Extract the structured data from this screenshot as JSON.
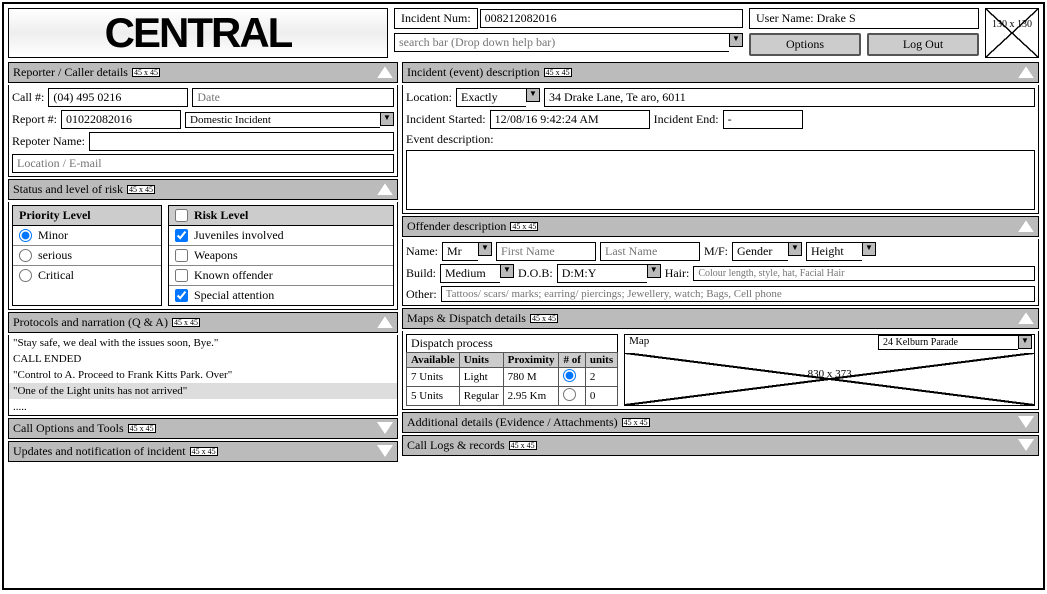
{
  "header": {
    "logo": "CENTRAL",
    "incident_num_label": "Incident Num:",
    "incident_num": "008212082016",
    "user_name_label": "User Name:",
    "user_name": "Drake S",
    "search_placeholder": "search bar (Drop down help bar)",
    "options_btn": "Options",
    "logout_btn": "Log Out",
    "avatar_text": "130 x 130"
  },
  "reporter": {
    "title": "Reporter / Caller details",
    "resize": "45 x 45",
    "call_num_label": "Call #:",
    "call_num": "(04) 495 0216",
    "date_label": "Date",
    "report_num_label": "Report #:",
    "report_num": "01022082016",
    "report_type": "Domestic Incident",
    "reporter_name_label": "Repoter Name:",
    "location_label": "Location / E-mail"
  },
  "status": {
    "title": "Status and level of risk",
    "resize": "45 x 45",
    "priority_title": "Priority Level",
    "priority": [
      "Minor",
      "serious",
      "Critical"
    ],
    "risk_title": "Risk Level",
    "risk": [
      "Juveniles involved",
      "Weapons",
      "Known offender",
      "Special attention"
    ]
  },
  "protocols": {
    "title": "Protocols and narration (Q & A)",
    "resize": "45 x 45",
    "lines": [
      "\"Stay safe, we deal with the issues soon, Bye.\"",
      "CALL ENDED",
      "\"Control to A. Proceed to Frank Kitts Park. Over\"",
      "\"One of the Light units has not arrived\"",
      "....."
    ]
  },
  "call_options": {
    "title": "Call Options and Tools",
    "resize": "45 x 45"
  },
  "updates": {
    "title": "Updates and notification of incident",
    "resize": "45 x 45"
  },
  "incident": {
    "title": "Incident (event) description",
    "resize": "45 x 45",
    "location_label": "Location:",
    "location_type": "Exactly",
    "address": "34 Drake Lane, Te aro, 6011",
    "started_label": "Incident Started:",
    "started": "12/08/16 9:42:24 AM",
    "end_label": "Incident End:",
    "end": "-",
    "desc_label": "Event description:"
  },
  "offender": {
    "title": "Offender description",
    "resize": "45 x 45",
    "name_label": "Name:",
    "title_val": "Mr",
    "first_name_ph": "First Name",
    "last_name_ph": "Last Name",
    "mf_label": "M/F:",
    "gender": "Gender",
    "height": "Height",
    "build_label": "Build:",
    "build": "Medium",
    "dob_label": "D.O.B:",
    "dob": "D:M:Y",
    "hair_label": "Hair:",
    "hair_ph": "Colour length, style, hat, Facial Hair",
    "other_label": "Other:",
    "other_ph": "Tattoos/ scars/ marks; earring/ piercings; Jewellery, watch; Bags, Cell phone"
  },
  "dispatch": {
    "title": "Maps & Dispatch details",
    "resize": "45 x 45",
    "process_title": "Dispatch process",
    "cols": [
      "Available",
      "Units",
      "Proximity",
      "# of",
      "units"
    ],
    "rows": [
      {
        "available": "7 Units",
        "units": "Light",
        "proximity": "780 M",
        "num": "2"
      },
      {
        "available": "5 Units",
        "units": "Regular",
        "proximity": "2.95 Km",
        "num": "0"
      }
    ],
    "map_label": "Map",
    "map_addr": "24 Kelburn Parade",
    "map_dim": "830 x 373"
  },
  "additional": {
    "title": "Additional details (Evidence / Attachments)",
    "resize": "45 x 45"
  },
  "call_logs": {
    "title": "Call Logs & records",
    "resize": "45 x 45"
  }
}
